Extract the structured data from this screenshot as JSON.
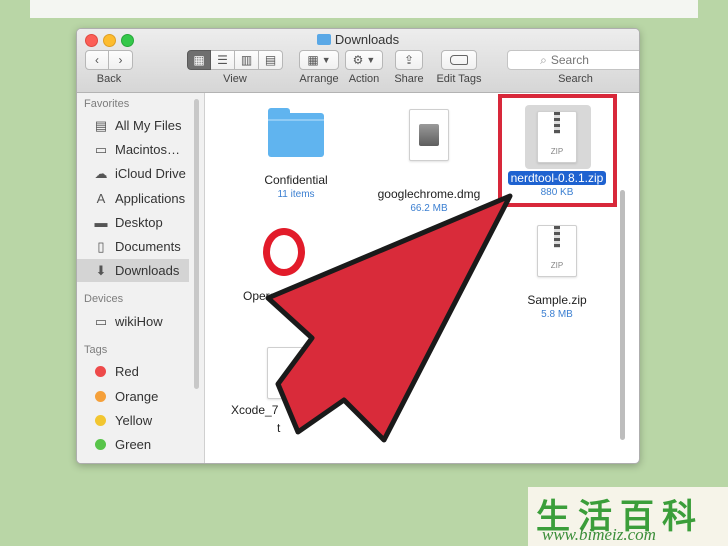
{
  "window": {
    "title": "Downloads"
  },
  "toolbar": {
    "back_label": "Back",
    "view_label": "View",
    "arrange_label": "Arrange",
    "action_label": "Action",
    "share_label": "Share",
    "edit_tags_label": "Edit Tags",
    "search_label": "Search",
    "search_placeholder": "Search"
  },
  "sidebar": {
    "favorites_header": "Favorites",
    "favorites": [
      {
        "label": "All My Files",
        "icon": "all-files-icon"
      },
      {
        "label": "Macintos…",
        "icon": "hard-drive-icon"
      },
      {
        "label": "iCloud Drive",
        "icon": "cloud-icon"
      },
      {
        "label": "Applications",
        "icon": "applications-icon"
      },
      {
        "label": "Desktop",
        "icon": "desktop-icon"
      },
      {
        "label": "Documents",
        "icon": "documents-icon"
      },
      {
        "label": "Downloads",
        "icon": "downloads-icon",
        "selected": true
      }
    ],
    "devices_header": "Devices",
    "devices": [
      {
        "label": "wikiHow",
        "icon": "disk-icon"
      }
    ],
    "tags_header": "Tags",
    "tags": [
      {
        "label": "Red",
        "color": "#ee4a4a"
      },
      {
        "label": "Orange",
        "color": "#f5a03a"
      },
      {
        "label": "Yellow",
        "color": "#f2c630"
      },
      {
        "label": "Green",
        "color": "#58c44a"
      }
    ]
  },
  "files": [
    {
      "name": "Confidential",
      "meta": "11 items",
      "kind": "folder"
    },
    {
      "name": "googlechrome.dmg",
      "meta": "66.2 MB",
      "kind": "dmg"
    },
    {
      "name": "nerdtool-0.8.1.zip",
      "meta": "880 KB",
      "kind": "zip",
      "selected": true
    },
    {
      "name": "Opera",
      "meta": "",
      "kind": "app"
    },
    {
      "name": "Sample.zip",
      "meta": "5.8 MB",
      "kind": "zip"
    },
    {
      "name": "Xcode_7",
      "name_tail": "t",
      "meta": "",
      "kind": "doc"
    }
  ],
  "icons": {
    "zip_text": "ZIP"
  },
  "colors": {
    "highlight_box": "#d8283a",
    "arrow": "#d92b3a",
    "selection": "#1e62d0"
  },
  "watermark": {
    "chars": "生活百科",
    "url": "www.bimeiz.com"
  }
}
